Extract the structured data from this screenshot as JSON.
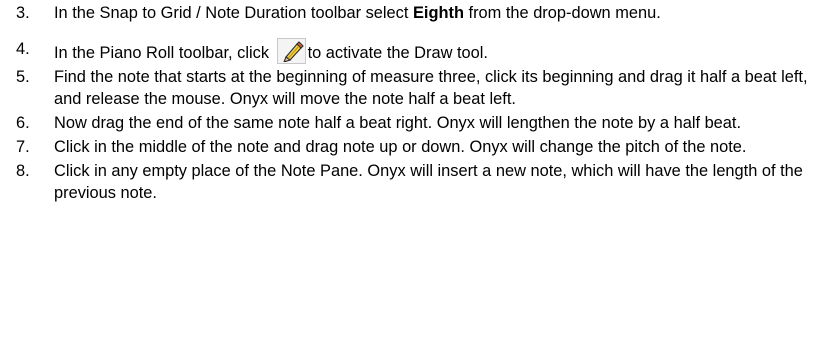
{
  "steps": [
    {
      "number": "3.",
      "text_before": "In the Snap to Grid / Note Duration toolbar select ",
      "bold": "Eighth",
      "text_after": " from the drop-down menu."
    },
    {
      "number": "4.",
      "text_before": "In the Piano Roll toolbar, click ",
      "icon": "pencil-draw-icon",
      "text_after": "to activate the Draw tool."
    },
    {
      "number": "5.",
      "text": "Find the note that starts at the beginning of measure three, click its beginning and drag it half a beat left, and release the mouse. Onyx will move the note half a beat left."
    },
    {
      "number": "6.",
      "text": "Now drag the end of the same note half a beat right. Onyx will lengthen the note by a half beat."
    },
    {
      "number": "7.",
      "text": "Click in the middle of the note and drag note up or down. Onyx will change the pitch of the note."
    },
    {
      "number": "8.",
      "text": "Click in any empty place of the Note Pane. Onyx will insert a new note, which will have the length of the previous note."
    }
  ]
}
